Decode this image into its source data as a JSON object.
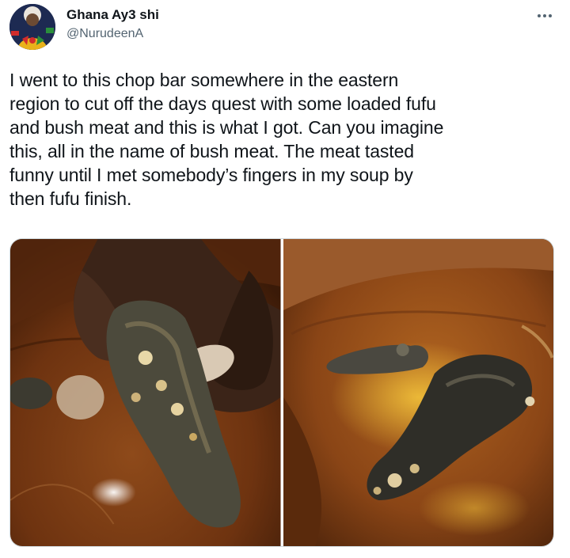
{
  "tweet": {
    "author": {
      "display_name": "Ghana Ay3 shi",
      "handle": "@NurudeenA",
      "avatar": "profile-avatar"
    },
    "more_icon": "more-horizontal-icon",
    "text": "I went to this chop bar somewhere in the eastern\nregion to cut off the days quest with some loaded fufu\nand bush meat and this is what I got. Can you imagine\nthis, all in the name of bush meat. The meat tasted\nfunny until I met somebody’s fingers in my soup by\nthen fufu finish.",
    "media": [
      {
        "kind": "photo",
        "subject": "hand holding meat in soup"
      },
      {
        "kind": "photo",
        "subject": "meat pieces in soup bowl"
      }
    ]
  },
  "colors": {
    "text": "#0f1419",
    "secondary": "#536471",
    "border": "#cfd9de",
    "soup": "#7a3a12",
    "bowl": "#a0552a"
  }
}
